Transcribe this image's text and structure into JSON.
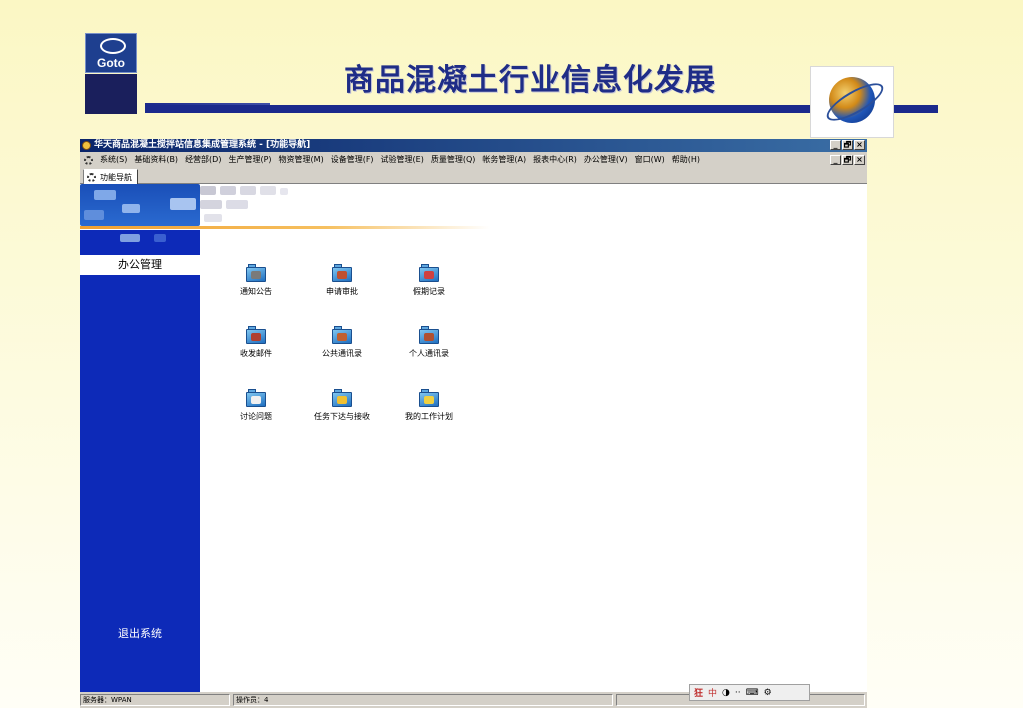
{
  "slide": {
    "logo_text": "Goto",
    "title": "商品混凝土行业信息化发展",
    "colors": {
      "title": "#1f2d87",
      "bar": "#1b2a8c",
      "background": "#fbf7c4"
    }
  },
  "window": {
    "title": "华天商品混凝土搅拌站信息集成管理系统 - [功能导航]",
    "controls": {
      "minimize": "_",
      "restore": "🗗",
      "close": "×"
    },
    "menus": [
      "系统(S)",
      "基础资料(B)",
      "经营部(D)",
      "生产管理(P)",
      "物资管理(M)",
      "设备管理(F)",
      "试验管理(E)",
      "质量管理(Q)",
      "帐务管理(A)",
      "报表中心(R)",
      "办公管理(V)",
      "窗口(W)",
      "帮助(H)"
    ],
    "tab_label": "功能导航"
  },
  "sidebar": {
    "active_item": "办公管理",
    "exit_label": "退出系统",
    "color": "#0d2ab8"
  },
  "modules": [
    {
      "label": "通知公告",
      "icon": "notice-folder-icon"
    },
    {
      "label": "申请审批",
      "icon": "approval-folder-icon"
    },
    {
      "label": "假期记录",
      "icon": "leave-record-folder-icon"
    },
    {
      "label": "收发邮件",
      "icon": "mail-folder-icon"
    },
    {
      "label": "公共通讯录",
      "icon": "public-contacts-folder-icon"
    },
    {
      "label": "个人通讯录",
      "icon": "personal-contacts-folder-icon"
    },
    {
      "label": "讨论问题",
      "icon": "discussion-folder-icon"
    },
    {
      "label": "任务下达与接收",
      "icon": "task-folder-icon"
    },
    {
      "label": "我的工作计划",
      "icon": "work-plan-folder-icon"
    }
  ],
  "status": {
    "server": "服务器：WPAN",
    "operator": "操作员：4"
  },
  "ime": {
    "label": "狂",
    "mode": "中"
  }
}
